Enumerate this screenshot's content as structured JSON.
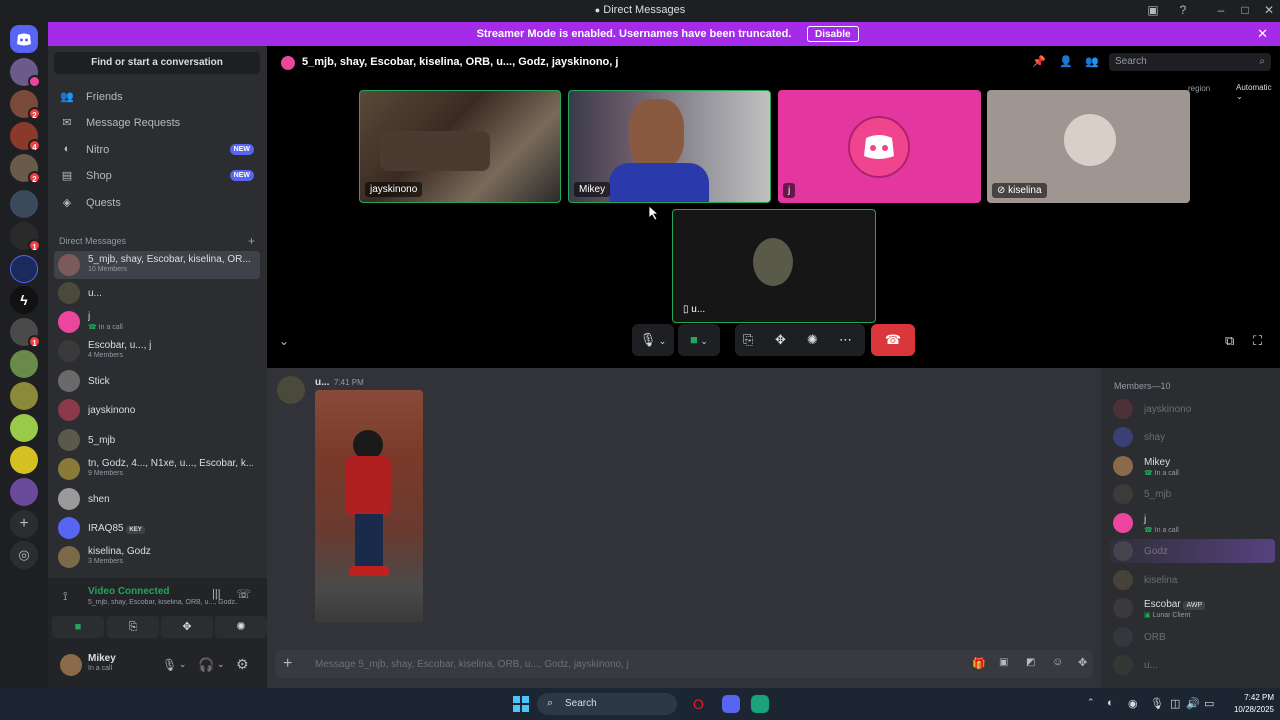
{
  "window": {
    "title": "Direct Messages"
  },
  "banner": {
    "text": "Streamer Mode is enabled. Usernames have been truncated.",
    "disable_label": "Disable"
  },
  "sidebar": {
    "find_label": "Find or start a conversation",
    "nav": [
      {
        "label": "Friends",
        "icon": "friends-icon"
      },
      {
        "label": "Message Requests",
        "icon": "mail-icon"
      },
      {
        "label": "Nitro",
        "icon": "nitro-icon",
        "badge": "NEW"
      },
      {
        "label": "Shop",
        "icon": "shop-icon",
        "badge": "NEW"
      },
      {
        "label": "Quests",
        "icon": "quests-icon"
      }
    ],
    "dm_header": "Direct Messages",
    "dms": [
      {
        "name": "5_mjb, shay, Escobar, kiselina, OR...",
        "sub": "10 Members",
        "color": "#7a5a5a"
      },
      {
        "name": "u...",
        "sub": "",
        "color": "#4a4a3a"
      },
      {
        "name": "j",
        "sub": "In a call",
        "color": "#eb459e"
      },
      {
        "name": "Escobar, u..., j",
        "sub": "4 Members",
        "color": "#3a3a3a"
      },
      {
        "name": "Stick",
        "sub": "",
        "color": "#6a6a6a"
      },
      {
        "name": "jayskinono",
        "sub": "",
        "color": "#8a3a4a"
      },
      {
        "name": "5_mjb",
        "sub": "",
        "color": "#5a5a4a"
      },
      {
        "name": "tn, Godz, 4..., N1xe, u..., Escobar, k...",
        "sub": "9 Members",
        "color": "#8a7a3a"
      },
      {
        "name": "shen",
        "sub": "",
        "color": "#9a9a9a"
      },
      {
        "name": "IRAQ85",
        "sub": "",
        "tag": "KEY",
        "color": "#5865f2"
      },
      {
        "name": "kiselina, Godz",
        "sub": "3 Members",
        "color": "#7a6a4a"
      }
    ],
    "voice": {
      "status": "Video Connected",
      "channel": "5_mjb, shay, Escobar, kiselina, ORB, u..., Godz..."
    },
    "user": {
      "name": "Mikey",
      "status": "In a call"
    }
  },
  "call": {
    "title": "5_mjb, shay, Escobar, kiselina, ORB, u..., Godz, jayskinono, j",
    "search_placeholder": "Search",
    "region_label": "region",
    "region_value": "Automatic",
    "tiles": [
      {
        "label": "jayskinono"
      },
      {
        "label": "Mikey"
      },
      {
        "label": "j"
      },
      {
        "label": "kiselina"
      },
      {
        "label": "u..."
      }
    ]
  },
  "chat": {
    "message": {
      "author": "u...",
      "time": "7:41 PM"
    },
    "input_placeholder": "Message 5_mjb, shay, Escobar, kiselina, ORB, u..., Godz, jayskinono, j"
  },
  "members": {
    "header": "Members—10",
    "list": [
      {
        "name": "jayskinono",
        "faded": true,
        "color": "#8a3a4a"
      },
      {
        "name": "shay",
        "faded": true,
        "color": "#5865f2"
      },
      {
        "name": "Mikey",
        "sub": "In a call",
        "faded": false,
        "color": "#8a6a4a"
      },
      {
        "name": "5_mjb",
        "faded": true,
        "color": "#5a5a4a"
      },
      {
        "name": "j",
        "sub": "In a call",
        "faded": false,
        "color": "#eb459e"
      },
      {
        "name": "Godz",
        "faded": true,
        "color": "#6a6a6a"
      },
      {
        "name": "kiselina",
        "faded": true,
        "color": "#7a6a4a"
      },
      {
        "name": "Escobar",
        "tag": "AWP",
        "sub": "Lunar Client",
        "faded": false,
        "color": "#3a3a3a"
      },
      {
        "name": "ORB",
        "faded": true,
        "color": "#4a4a5a"
      },
      {
        "name": "u...",
        "faded": true,
        "color": "#4a4a3a"
      }
    ]
  },
  "taskbar": {
    "search_label": "Search",
    "time": "7:42 PM",
    "date": "10/28/2025"
  },
  "colors": {
    "banner": "#a42ce9",
    "accent": "#5865f2",
    "green": "#23a55a",
    "hangup": "#da373c"
  }
}
